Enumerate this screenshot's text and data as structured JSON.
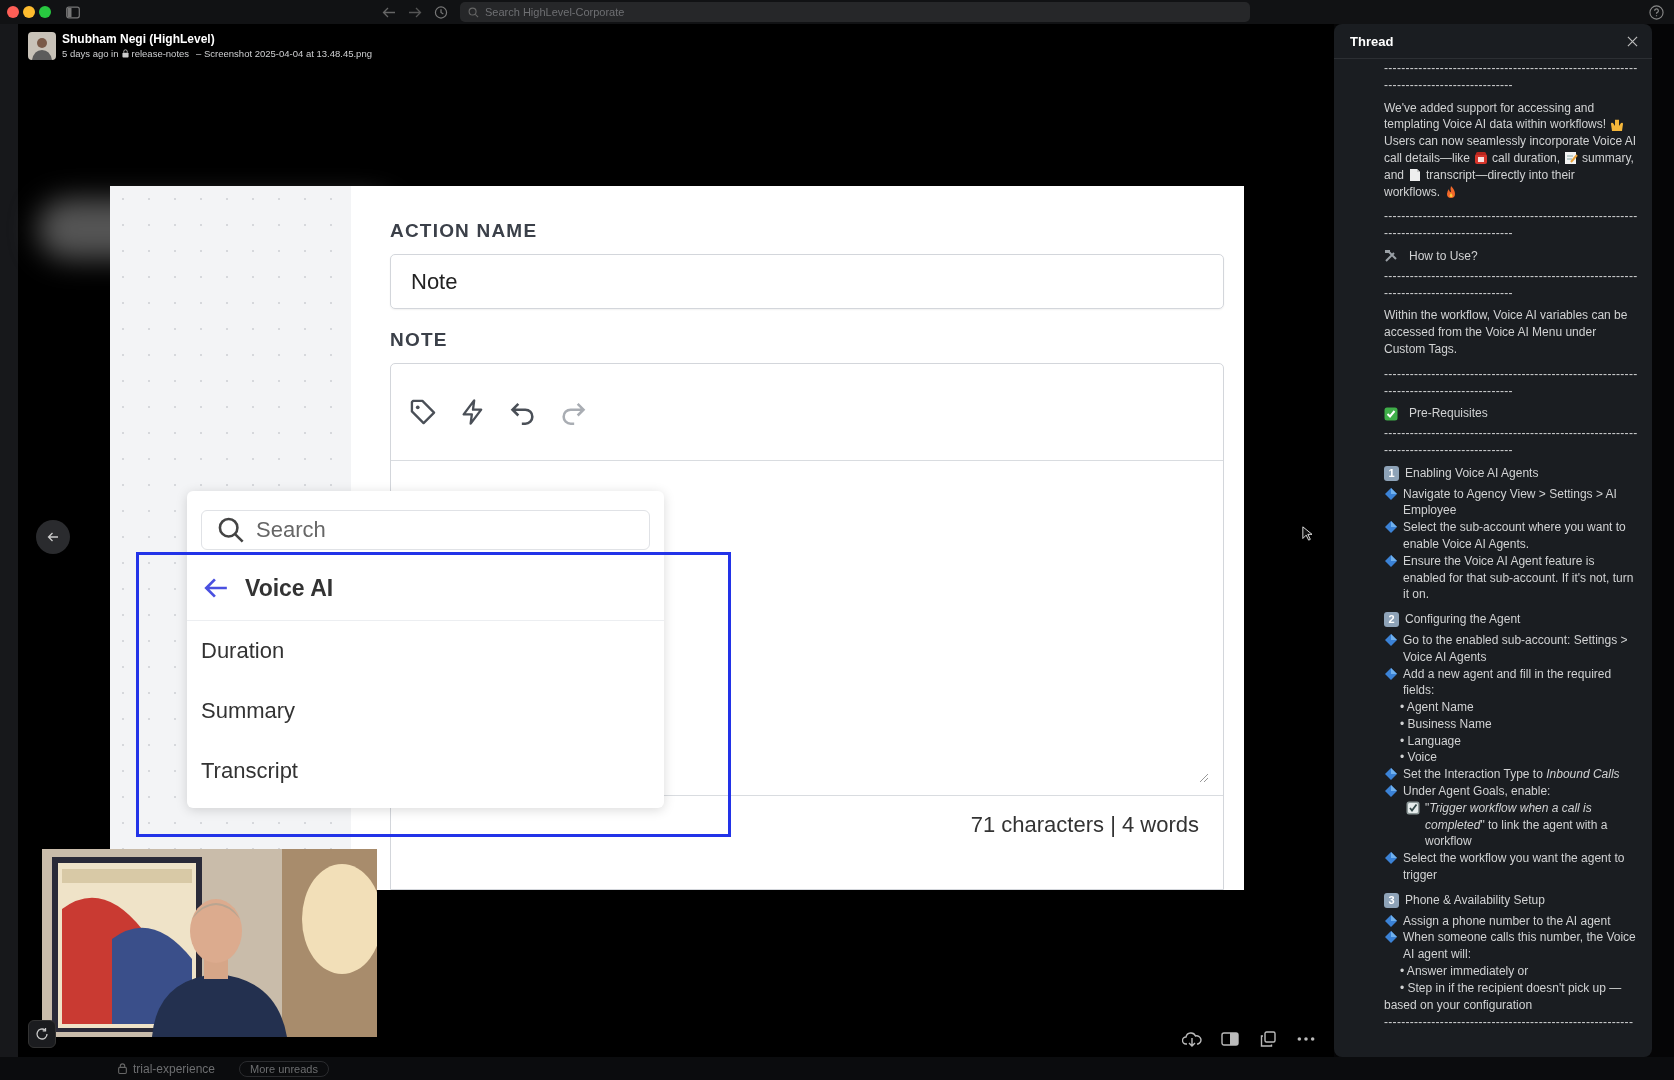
{
  "topbar": {
    "search": {
      "placeholder": "Search HighLevel-Corporate"
    }
  },
  "message": {
    "author": "Shubham Negi (HighLevel)",
    "time": "5 days ago in",
    "channel": "release-notes",
    "file": "– Screenshot 2025-04-04 at 13.48.45.png"
  },
  "screenshot": {
    "action_label": "ACTION NAME",
    "action_value": "Note",
    "note_label": "NOTE",
    "toolbar": [
      {
        "kind": "tag",
        "disabled": false
      },
      {
        "kind": "bolt",
        "disabled": false
      },
      {
        "kind": "undo",
        "disabled": false
      },
      {
        "kind": "redo",
        "disabled": true
      }
    ],
    "counter": "71 characters | 4 words",
    "menu": {
      "search_placeholder": "Search",
      "back_title": "Voice AI",
      "items": [
        "Duration",
        "Summary",
        "Transcript"
      ]
    }
  },
  "thread": {
    "title": "Thread",
    "blocks": [
      {
        "kind": "rule",
        "text": "-----------------------------------------------------------------------------------------"
      },
      {
        "kind": "para",
        "lines": [
          [
            {
              "kind": "text",
              "text": "We've added support for accessing and"
            }
          ],
          [
            {
              "kind": "text",
              "text": "templating Voice AI data within workflows!"
            },
            {
              "kind": "hands"
            }
          ],
          [
            {
              "kind": "text",
              "text": "Users can now seamlessly incorporate Voice AI"
            }
          ],
          [
            {
              "kind": "text",
              "text": "call details—like"
            },
            {
              "kind": "phone"
            },
            {
              "kind": "text",
              "text": "call duration,"
            },
            {
              "kind": "memo"
            },
            {
              "kind": "text",
              "text": "summary,"
            }
          ],
          [
            {
              "kind": "text",
              "text": "and"
            },
            {
              "kind": "page"
            },
            {
              "kind": "text",
              "text": "transcript—directly into their"
            }
          ],
          [
            {
              "kind": "text",
              "text": "workflows."
            },
            {
              "kind": "fire"
            }
          ]
        ]
      },
      {
        "kind": "rule",
        "text": "-----------------------------------------------------------------------------------------"
      },
      {
        "kind": "tools-heading",
        "text": "How to Use?"
      },
      {
        "kind": "rule",
        "text": "-----------------------------------------------------------------------------------------"
      },
      {
        "kind": "para",
        "lines": [
          [
            {
              "kind": "text",
              "text": "Within the workflow, Voice AI variables can be accessed from the Voice AI Menu under Custom Tags."
            }
          ]
        ]
      },
      {
        "kind": "rule",
        "text": "-----------------------------------------------------------------------------------------"
      },
      {
        "kind": "check-heading",
        "text": "Pre-Requisites"
      },
      {
        "kind": "rule",
        "text": "-----------------------------------------------------------------------------------------"
      },
      {
        "kind": "number-heading",
        "number": "1",
        "text": "Enabling Voice AI Agents"
      },
      {
        "kind": "diamond-line",
        "text": "Navigate to Agency View > Settings > AI Employee"
      },
      {
        "kind": "diamond-line",
        "text": "Select the sub-account where you want to enable Voice AI Agents."
      },
      {
        "kind": "diamond-line",
        "text": "Ensure the Voice AI Agent feature is enabled for that sub-account. If it's not, turn it on."
      },
      {
        "kind": "number-heading",
        "number": "2",
        "text": "Configuring the Agent"
      },
      {
        "kind": "diamond-line",
        "text": "Go to the enabled sub-account: Settings > Voice AI Agents"
      },
      {
        "kind": "diamond-line",
        "text": "Add a new agent and fill in the required fields:"
      },
      {
        "kind": "sub",
        "text": "• Agent Name"
      },
      {
        "kind": "sub",
        "text": "• Business Name"
      },
      {
        "kind": "sub",
        "text": "• Language"
      },
      {
        "kind": "sub",
        "text": "• Voice"
      },
      {
        "kind": "diamond-line",
        "text": "Set the Interaction Type to *Inbound Calls*"
      },
      {
        "kind": "diamond-line",
        "text": "Under Agent Goals, enable:"
      },
      {
        "kind": "checkbox-line",
        "text": "\"*Trigger workflow when a call is completed*\" to link the agent with a workflow"
      },
      {
        "kind": "diamond-line",
        "text": "Select the workflow you want the agent to trigger"
      },
      {
        "kind": "number-heading",
        "number": "3",
        "text": "Phone & Availability Setup"
      },
      {
        "kind": "diamond-line",
        "text": "Assign a phone number to the AI agent"
      },
      {
        "kind": "diamond-line",
        "text": "When someone calls this number, the Voice AI agent will:"
      },
      {
        "kind": "sub",
        "text": "• Answer immediately or"
      },
      {
        "kind": "sub",
        "text": "• Step in if the recipient doesn't pick up — based on your configuration"
      },
      {
        "kind": "rule",
        "text": "----------------------------------------------------------"
      }
    ]
  },
  "footer": {
    "channel": "trial-experience",
    "unreads": "More unreads"
  }
}
